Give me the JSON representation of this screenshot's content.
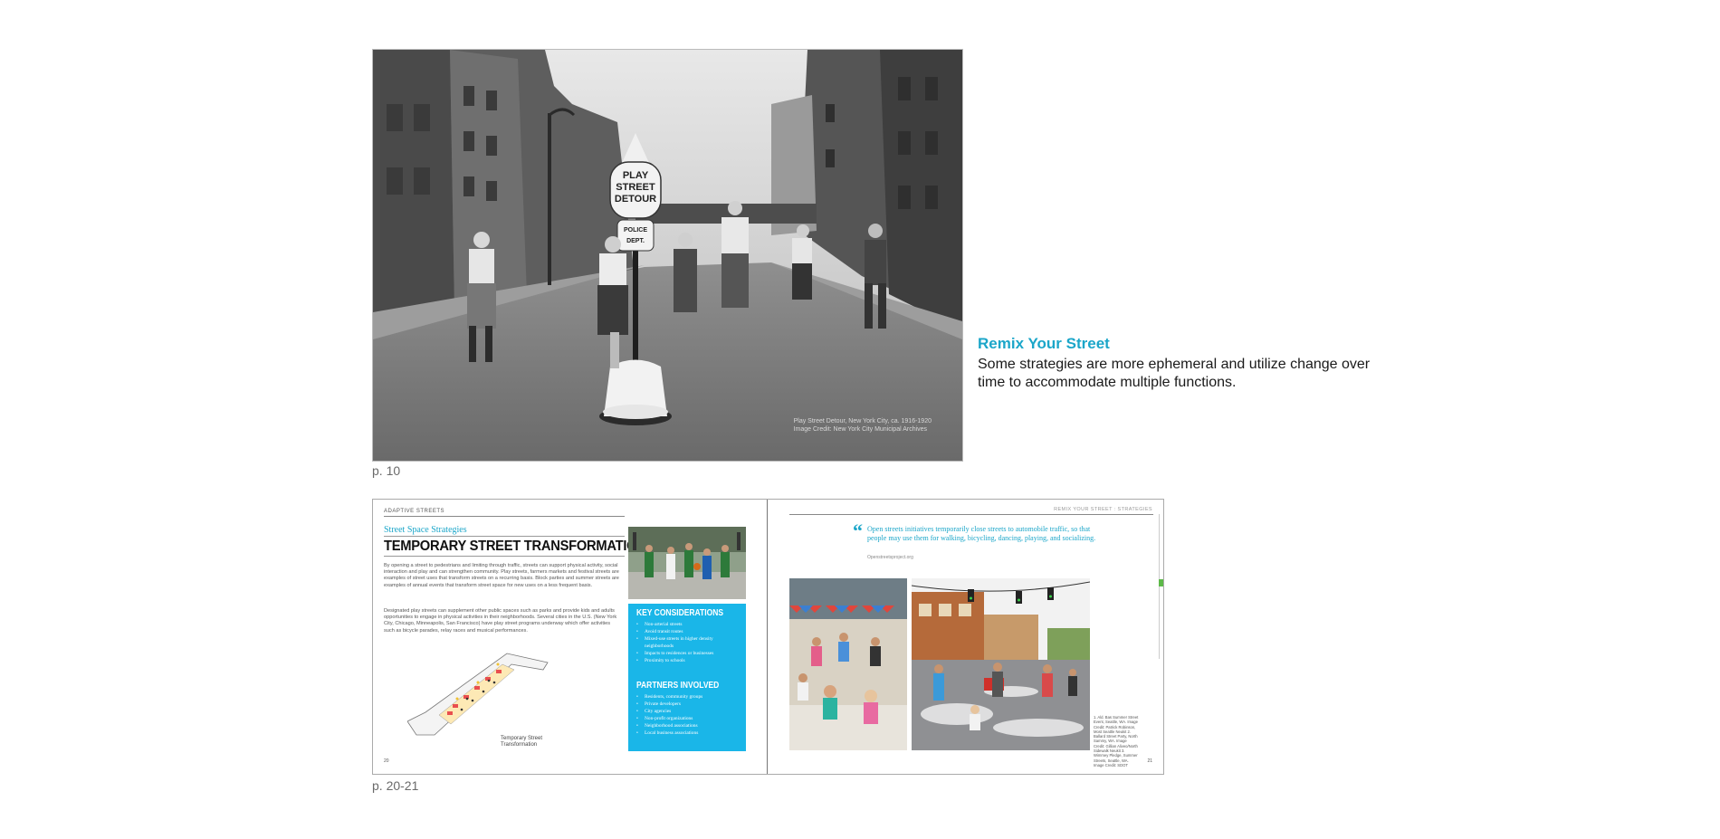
{
  "photo": {
    "sign_lines": [
      "PLAY",
      "STREET",
      "DETOUR"
    ],
    "sign_sub": [
      "POLICE",
      "DEPT."
    ],
    "credit_lines": [
      "Play Street Detour, New York City, ca. 1916-1920",
      "Image Credit: New York City Municipal Archives"
    ]
  },
  "captions": {
    "page1": "p. 10",
    "page2": "p. 20-21"
  },
  "intro": {
    "title": "Remix Your Street",
    "text": "Some strategies are more ephemeral and utilize change over time to accommodate multiple functions."
  },
  "spread": {
    "left": {
      "running_head": "ADAPTIVE STREETS",
      "kicker": "Street Space Strategies",
      "headline": "TEMPORARY STREET TRANSFORMATION",
      "body1": "By opening a street to pedestrians and limiting through traffic, streets can support physical activity, social interaction and play and can strengthen community. Play streets, farmers markets and festival streets are examples of street uses that transform streets on a recurring basis. Block parties and summer streets are examples of annual events that transform street space for new uses on a less frequent basis.",
      "body2": "Designated play streets can supplement other public spaces such as parks and provide kids and adults opportunities to engage in physical activities in their neighborhoods. Several cities in the U.S. (New York City, Chicago, Minneapolis, San Francisco) have play street programs underway which offer activities such as bicycle parades, relay races and musical performances.",
      "diagram_label": [
        "Temporary Street",
        "Transformation"
      ],
      "page_number": "20",
      "key_title": "KEY CONSIDERATIONS",
      "key_items": [
        "Non-arterial streets",
        "Avoid transit routes",
        "Mixed-use streets in higher density neighborhoods",
        "Impacts to residences or businesses",
        "Proximity to schools"
      ],
      "partners_title": "PARTNERS INVOLVED",
      "partners_items": [
        "Residents, community groups",
        "Private developers",
        "City agencies",
        "Non-profit organizations",
        "Neighborhood associations",
        "Local business associations"
      ]
    },
    "right": {
      "running_head": "REMIX YOUR STREET : STRATEGIES",
      "quote": "Open streets initiatives temporarily close streets to automobile traffic, so that people may use them for walking, bicycling, dancing, playing, and socializing.",
      "quote_source": "Openstreetsproject.org",
      "photo_caption": "1. Ald. Bas Summer Street Event, Seattle, WA. Image Credit: Patrick Robinson, Most Seattle Neukit 2. Ballard Street Party, North Sammy, WA. Image Credit: Gillian Aliveo/North Sidewalk Neukit 3. Wimmey Pledge, Summer Streets, Seattle, WA. Image Credit: SDOT",
      "page_number": "21"
    }
  }
}
